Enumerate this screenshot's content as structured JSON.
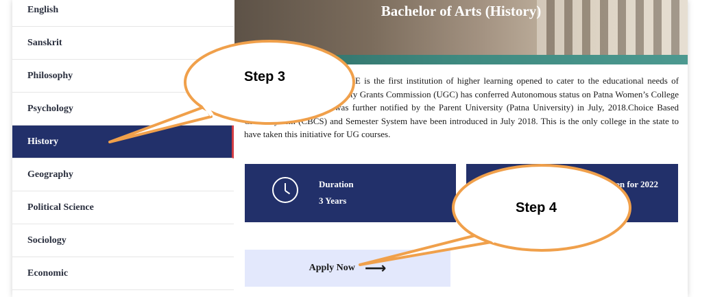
{
  "sidebar": {
    "items": [
      {
        "label": "English"
      },
      {
        "label": "Sanskrit"
      },
      {
        "label": "Philosophy"
      },
      {
        "label": "Psychology"
      },
      {
        "label": "History",
        "active": true
      },
      {
        "label": "Geography"
      },
      {
        "label": "Political Science"
      },
      {
        "label": "Sociology"
      },
      {
        "label": "Economic"
      }
    ]
  },
  "main": {
    "banner_title": "Bachelor of Arts (History)",
    "description": "PATNA WOMEN'S COLLEGE is the first institution of higher learning opened to cater to the educational needs of women in Bihar.The University Grants Commission (UGC) has conferred Autonomous status on Patna Women’s College in January, 2018 which was further notified by the Parent University (Patna University) in July, 2018.Choice Based Credit System (CBCS) and Semester System have been introduced in July 2018. This is the only college in the state to have taken this initiative for UG courses.",
    "duration_card": {
      "label": "Duration",
      "value": "3 Years",
      "icon": "clock-icon"
    },
    "admission_card": {
      "text": "Admission Open for 2022"
    },
    "apply": {
      "label": "Apply Now",
      "arrow": "⟶"
    }
  },
  "callouts": {
    "step3": "Step 3",
    "step4": "Step 4"
  },
  "colors": {
    "navy": "#22306a",
    "accent_red": "#d23c44",
    "callout_fill": "#ffffff",
    "callout_stroke": "#f0a04b",
    "apply_bg": "#e3e8fc"
  }
}
